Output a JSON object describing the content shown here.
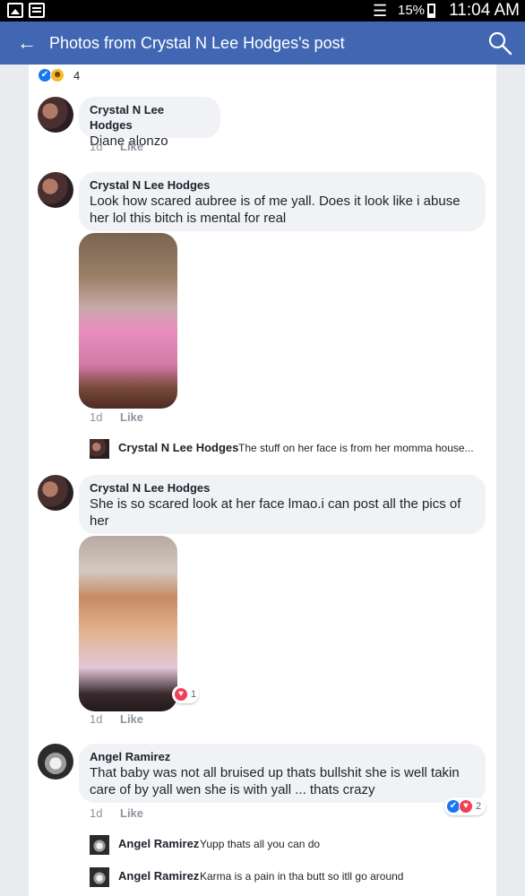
{
  "status_bar": {
    "battery": "15%",
    "time": "11:04 AM",
    "icons": [
      "image-notification-icon",
      "message-notification-icon",
      "wifi-icon",
      "battery-icon"
    ]
  },
  "app_bar": {
    "title": "Photos from Crystal N Lee Hodges's post",
    "back_icon": "arrow-left-icon",
    "search_icon": "search-icon",
    "color": "#4267b2"
  },
  "reactions": {
    "count": "4",
    "types": [
      "like",
      "haha"
    ]
  },
  "comments": [
    {
      "author": "Crystal N Lee Hodges",
      "text": "Diane alonzo",
      "time": "1d",
      "action": "Like"
    },
    {
      "author": "Crystal N Lee Hodges",
      "text": "Look how scared aubree is of me yall. Does it look like i abuse her lol this bitch is mental for real",
      "time": "1d",
      "action": "Like",
      "has_photo": true,
      "reply": {
        "author": "Crystal N Lee Hodges",
        "text": "The stuff on her face is from her momma house..."
      }
    },
    {
      "author": "Crystal N Lee Hodges",
      "text": "She is so scared look at her face lmao.i can post all the pics of her",
      "time": "1d",
      "action": "Like",
      "has_photo": true,
      "photo_reactions": "1"
    },
    {
      "author": "Angel Ramirez",
      "text": "That baby was not all bruised up  thats bullshit she is well takin care of by yall wen she is with yall ... thats crazy",
      "time": "1d",
      "action": "Like",
      "reactions": "2",
      "replies": [
        {
          "author": "Angel Ramirez",
          "text": "Yupp thats all you can do"
        },
        {
          "author": "Angel Ramirez",
          "text": "Karma is a pain in tha butt so itll go around"
        }
      ]
    }
  ]
}
